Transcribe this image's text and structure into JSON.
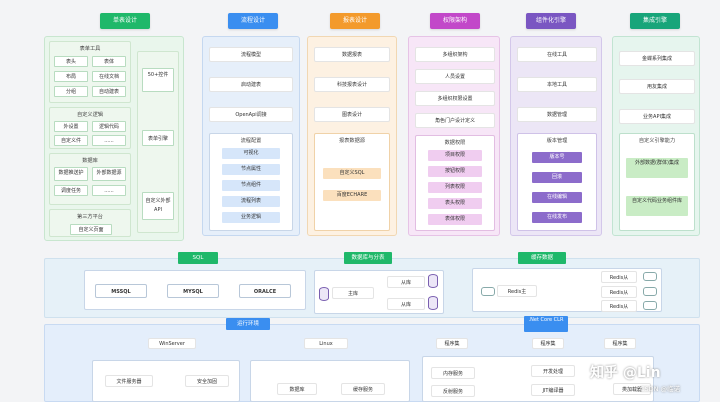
{
  "colors": {
    "green": "#1fb86a",
    "blue": "#3a8ef0",
    "orange": "#f39a2c",
    "pink": "#c248c9",
    "purple": "#7a56c2",
    "teal": "#18a57a"
  },
  "headers": [
    "单表设计",
    "流程设计",
    "报表设计",
    "权限架构",
    "组件化引擎",
    "集成引擎"
  ],
  "col1": {
    "form_engine": "表单工具",
    "form_items": [
      "表头",
      "表体",
      "布局",
      "在线文档",
      "分组",
      "自动建表"
    ],
    "custom_logic": "自定义逻辑",
    "logic_items": [
      "外设置",
      "逻辑代码",
      "自定义件",
      "......"
    ],
    "database": "数据库",
    "db_items": [
      "数据推送护",
      "外部数据源",
      "调度任务",
      "......"
    ],
    "third_party": "第三方平台",
    "third_items": [
      "自定义页面"
    ],
    "side_items": [
      "50+控件",
      "表单引擎",
      "自定义外部API"
    ]
  },
  "col2": {
    "top_items": [
      "流程模型",
      "启动建表",
      "OpenApi调接"
    ],
    "config": "流程配置",
    "config_items": [
      "可视化",
      "节点属性",
      "节点组件",
      "流程列表",
      "业务逻辑"
    ]
  },
  "col3": {
    "top_items": [
      "数据报表",
      "科技报表设计",
      "图表设计"
    ],
    "engine": "报表数据源",
    "engine_items": [
      "自定义SQL",
      "百度ECHARE"
    ]
  },
  "col4": {
    "top_items": [
      "多组织架构",
      "人员设置",
      "多组织权限设置",
      "角色门户设计定义"
    ],
    "perm": "数据权限",
    "perm_items": [
      "项目权限",
      "按钮权限",
      "列表权限",
      "表头权限",
      "表体权限"
    ]
  },
  "col5": {
    "top_items": [
      "在线工具",
      "本地工具",
      "数据管理"
    ],
    "ver": "版本管理",
    "ver_items": [
      "版本号",
      "回滚",
      "在线编辑",
      "在线发布"
    ]
  },
  "col6": {
    "top_items": [
      "金蝶系列集成",
      "用友集成",
      "业务API集成",
      "自定义引擎能力"
    ],
    "bottom_items": [
      "外部数据(群体)集成",
      "自定义代码业务组件库"
    ]
  },
  "mid": {
    "sql_label": "SQL",
    "sql_items": [
      "MSSQL",
      "MYSQL",
      "ORALCE"
    ],
    "sync_label": "数据库与分表",
    "master": "主库",
    "slaves": [
      "从库",
      "从库"
    ],
    "cache_label": "缓存数据",
    "redis_master": "Redis主",
    "redis_slaves": [
      "Redis从",
      "Redis从",
      "Redis从"
    ]
  },
  "bottom": {
    "runtime": "运行环境",
    "netcore": ".Net Core CLR",
    "win": "WinServer",
    "win_items": [
      "文件服务器",
      "安全加固"
    ],
    "linux": "Linux",
    "linux_items": [
      "数据库",
      "缓存服务"
    ],
    "service_headers": [
      "程序集",
      "程序集",
      "程序集"
    ],
    "service_items": [
      "内存服务",
      "开发处理",
      "JIT编译器",
      "类加载器",
      "反射服务"
    ]
  },
  "watermark": {
    "line1": "知乎 @Lin",
    "line2": "CSDN @临诺"
  }
}
